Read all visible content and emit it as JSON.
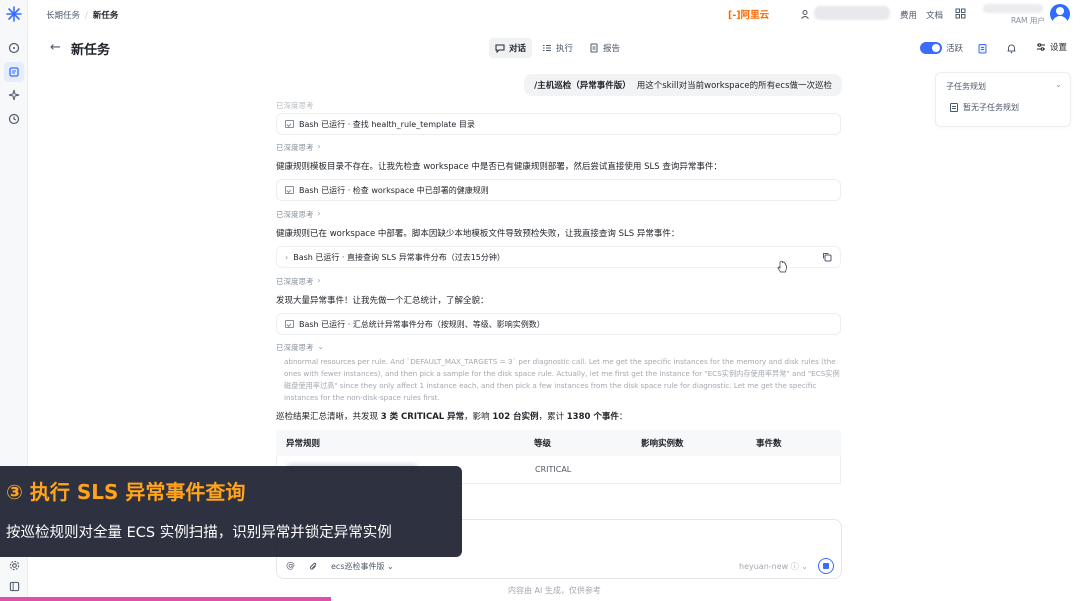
{
  "topbar": {
    "breadcrumb_parent": "长期任务",
    "breadcrumb_sep": "/",
    "breadcrumb_current": "新任务",
    "brand": "[-]阿里云",
    "link_fees": "费用",
    "link_docs": "文档",
    "account_sub": "RAM 用户"
  },
  "header": {
    "title": "新任务",
    "tabs": [
      {
        "label": "对话",
        "icon": "chat-icon"
      },
      {
        "label": "执行",
        "icon": "list-icon"
      },
      {
        "label": "报告",
        "icon": "report-icon"
      }
    ],
    "active_tab": "对话",
    "toggle_label": "活跃",
    "toggle_on": true,
    "settings_label": "设置"
  },
  "subtask_panel": {
    "title": "子任务规划",
    "empty": "暂无子任务规划"
  },
  "chat": {
    "user_message_tag": "/主机巡检（异常事件版）",
    "user_message_text": "用这个skill对当前workspace的所有ecs做一次巡检",
    "tool_calls": [
      "Bash 已运行 · 查找 health_rule_template 目录",
      "Bash 已运行 · 检查 workspace 中已部署的健康规则",
      "Bash 已运行 · 直接查询 SLS 异常事件分布（过去15分钟）",
      "Bash 已运行 · 汇总统计异常事件分布（按规则、等级、影响实例数）"
    ],
    "thinking_label": "已深度思考",
    "paragraphs": [
      "健康规则模板目录不存在。让我先检查 workspace 中是否已有健康规则部署，然后尝试直接使用 SLS 查询异常事件：",
      "健康规则已在 workspace 中部署。脚本因缺少本地模板文件导致预检失败，让我直接查询 SLS 异常事件：",
      "发现大量异常事件！让我先做一个汇总统计，了解全貌："
    ],
    "thinking_detail": "abnormal resources per rule. And `DEFAULT_MAX_TARGETS = 3` per diagnostic call. Let me get the specific instances for the memory and disk rules (the ones with fewer instances), and then pick a sample for the disk space rule. Actually, let me first get the instance for \"ECS实例内存使用率异常\" and \"ECS实例磁盘使用率过高\" since they only affect 1 instance each, and then pick a few instances from the disk space rule for diagnostic. Let me get the specific instances for the non-disk-space rules first.",
    "summary_prefix": "巡检结果汇总清晰，共发现 ",
    "summary_b1": "3 类 CRITICAL 异常",
    "summary_mid": "，影响 ",
    "summary_b2": "102 台实例",
    "summary_mid2": "，累计 ",
    "summary_b3": "1380 个事件",
    "summary_suffix": "：",
    "table": {
      "headers": [
        "异常规则",
        "等级",
        "影响实例数",
        "事件数"
      ],
      "rows": [
        {
          "level": "CRITICAL"
        }
      ]
    }
  },
  "input": {
    "skill_label": "ecs巡检事件版",
    "model_label": "heyuan-new",
    "disclaimer": "内容由 AI 生成，仅供参考"
  },
  "overlay": {
    "heading": "③ 执行 SLS 异常事件查询",
    "subtitle": "按巡检规则对全量 ECS 实例扫描，识别异常并锁定异常实例"
  },
  "colors": {
    "accent": "#3b6cff",
    "brand": "#ff6a00",
    "banner_heading": "#ffa41c",
    "progress": "#e14fad"
  }
}
